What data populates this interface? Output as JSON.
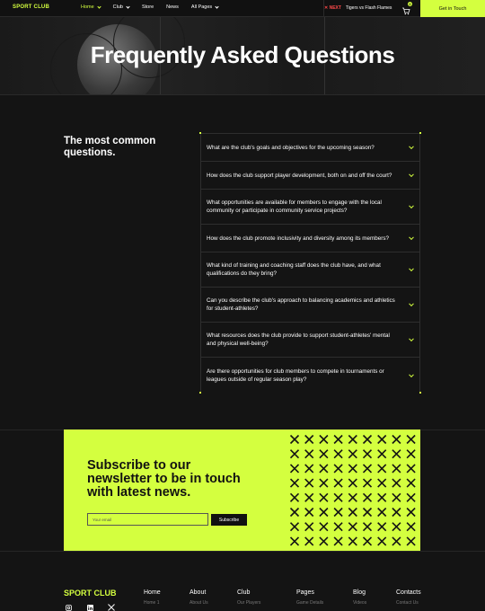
{
  "nav": {
    "brand": "SPORT CLUB",
    "items": [
      {
        "label": "Home",
        "dropdown": true,
        "active": true
      },
      {
        "label": "Club",
        "dropdown": true,
        "active": false
      },
      {
        "label": "Store",
        "dropdown": false,
        "active": false
      },
      {
        "label": "News",
        "dropdown": false,
        "active": false
      },
      {
        "label": "All Pages",
        "dropdown": true,
        "active": false
      }
    ],
    "next_label": "✕ NEXT",
    "next_match": "Tigers vs Flash Flames",
    "cart_count": "0",
    "cta_label": "Get in Touch"
  },
  "hero": {
    "title": "Frequently Asked Questions"
  },
  "faq": {
    "heading": "The most common questions.",
    "questions": [
      "What are the club's goals and objectives for the upcoming season?",
      "How does the club support player development, both on and off the court?",
      "What opportunities are available for members to engage with the local community or participate in community service projects?",
      "How does the club promote inclusivity and diversity among its members?",
      "What kind of training and coaching staff does the club have, and what qualifications do they bring?",
      "Can you describe the club's approach to balancing academics and athletics for student-athletes?",
      "What resources does the club provide to support student-athletes' mental and physical well-being?",
      "Are there opportunities for club members to compete in tournaments or leagues outside of regular season play?"
    ]
  },
  "subscribe": {
    "title": "Subscribe to our newsletter to be in touch with latest news.",
    "email_placeholder": "Your email",
    "button_label": "Subscribe"
  },
  "footer": {
    "brand": "SPORT CLUB",
    "columns": [
      {
        "heading": "Home",
        "link": "Home 1"
      },
      {
        "heading": "About",
        "link": "About Us"
      },
      {
        "heading": "Club",
        "link": "Our Players"
      },
      {
        "heading": "Pages",
        "link": "Game Details"
      },
      {
        "heading": "Blog",
        "link": "Videos"
      },
      {
        "heading": "Contacts",
        "link": "Contact Us"
      }
    ],
    "social": [
      "instagram-icon",
      "linkedin-icon",
      "x-icon"
    ]
  },
  "colors": {
    "accent": "#d4ff3f",
    "background": "#141414",
    "next_red": "#ff4a4a"
  }
}
